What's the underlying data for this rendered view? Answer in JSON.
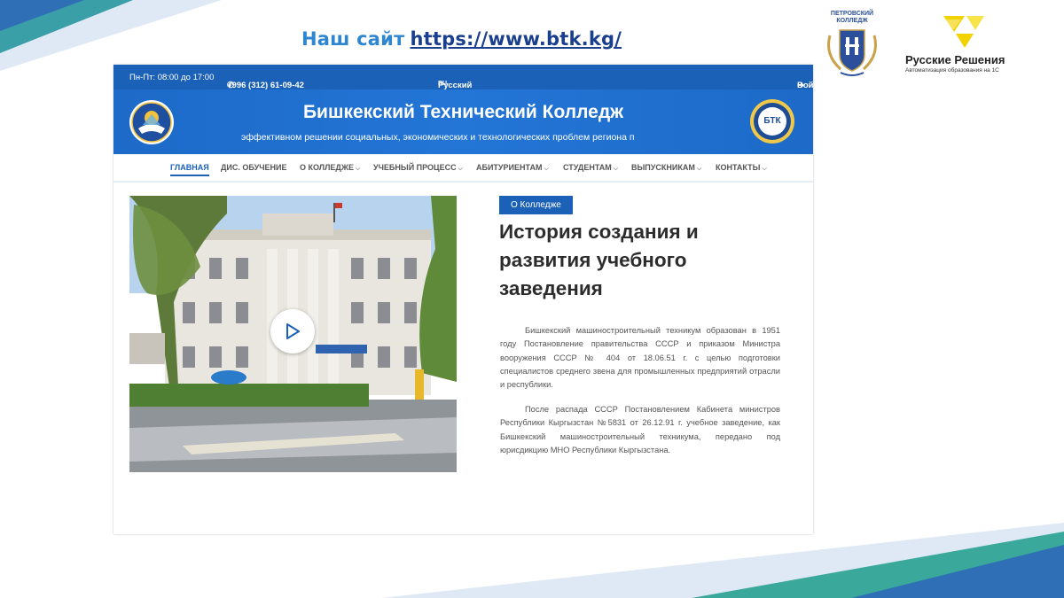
{
  "slide": {
    "title_prefix": "Наш сайт",
    "title_url": "https://www.btk.kg/"
  },
  "logos": {
    "petrovsky": "ПЕТРОВСКИЙ КОЛЛЕДЖ",
    "rr_name": "Русские Решения",
    "rr_sub": "Автоматизация образования на 1С"
  },
  "topbar": {
    "hours": "Пн-Пт: 08:00 до 17:00",
    "phone": "+996 (312) 61-09-42",
    "lang_code": "RU",
    "lang": "Русский",
    "login": "Войти"
  },
  "banner": {
    "title": "Бишкекский Технический Колледж",
    "slogan": "эффективном решении социальных, экономических и технологических проблем региона п",
    "emblem_right_text": "БТК"
  },
  "nav": {
    "items": [
      {
        "label": "ГЛАВНАЯ",
        "active": true,
        "dropdown": false
      },
      {
        "label": "ДИС. ОБУЧЕНИЕ",
        "active": false,
        "dropdown": false
      },
      {
        "label": "О КОЛЛЕДЖЕ",
        "active": false,
        "dropdown": true
      },
      {
        "label": "УЧЕБНЫЙ ПРОЦЕСС",
        "active": false,
        "dropdown": true
      },
      {
        "label": "АБИТУРИЕНТАМ",
        "active": false,
        "dropdown": true
      },
      {
        "label": "СТУДЕНТАМ",
        "active": false,
        "dropdown": true
      },
      {
        "label": "ВЫПУСКНИКАМ",
        "active": false,
        "dropdown": true
      },
      {
        "label": "КОНТАКТЫ",
        "active": false,
        "dropdown": true
      }
    ]
  },
  "content": {
    "badge": "О Колледже",
    "heading": "История создания и развития учебного заведения",
    "paragraph1": "Бишкекский машиностроительный техникум образован в 1951 году Постановление правительства СССР и приказом Министра вооружения СССР № 404 от 18.06.51 г. с целью подготовки специалистов среднего звена для промышленных предприятий отрасли и республики.",
    "paragraph2": "После распада СССР Постановлением Кабинета министров Республики Кыргызстан №5831 от 26.12.91 г. учебное заведение, как Бишкекский машиностроительный техникума, передано под юрисдикцию МНО Республики Кыргызстана."
  },
  "colors": {
    "primary": "#1c61b8",
    "title_blue": "#2e86d1",
    "url_blue": "#1a3f8f",
    "deco_teal": "#3aa89a",
    "deco_blue": "#2f6fb5"
  }
}
